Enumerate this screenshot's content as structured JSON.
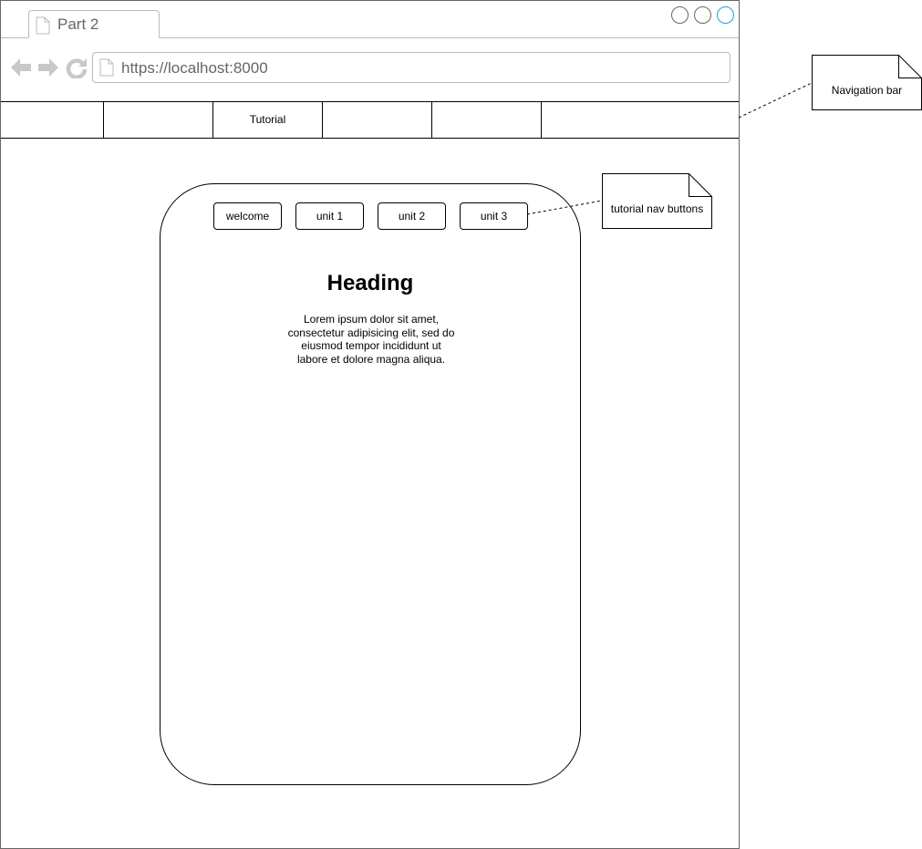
{
  "browser": {
    "tab_title": "Part 2",
    "url": "https://localhost:8000",
    "accent_color": "#1ba1e2"
  },
  "navbar": {
    "items": [
      "",
      "",
      "Tutorial",
      "",
      "",
      ""
    ]
  },
  "card": {
    "buttons": [
      "welcome",
      "unit 1",
      "unit 2",
      "unit 3"
    ],
    "heading": "Heading",
    "body": "Lorem ipsum dolor sit amet, consectetur adipisicing elit, sed do eiusmod tempor incididunt ut labore et dolore magna aliqua."
  },
  "annotations": {
    "navigation_bar": "Navigation bar",
    "tutorial_nav_buttons": "tutorial nav buttons"
  }
}
